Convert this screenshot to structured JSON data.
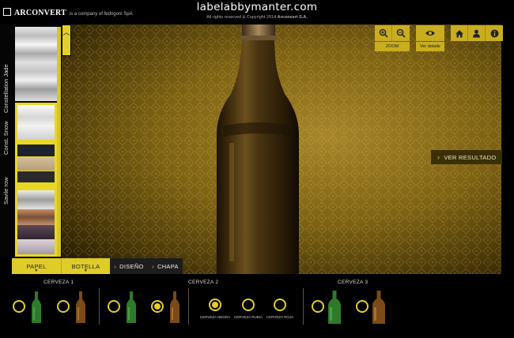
{
  "header": {
    "brand_name": "ARCONVERT",
    "brand_tagline": "is a company of fedrigoni SpA",
    "site_title": "labelabbymanter.com",
    "copyright_prefix": "All rights reserved & Copyright 2014",
    "copyright_company": "Arconvert S.A."
  },
  "sidebar": {
    "categories": [
      {
        "label": "Constellation Jade"
      },
      {
        "label": "Const. Snow"
      },
      {
        "label": "Savile row"
      }
    ]
  },
  "toolbar": {
    "zoom_label": "ZOOM",
    "detail_label": "Ver detalle",
    "zoom_in_icon": "zoom-in-icon",
    "zoom_out_icon": "zoom-out-icon",
    "eye_icon": "eye-icon",
    "home_icon": "home-icon",
    "user_icon": "user-icon",
    "info_icon": "info-icon",
    "accent_color": "#c8ad1f"
  },
  "stage": {
    "result_button": "VER RESULTADO"
  },
  "tabs": [
    {
      "label": "PAPEL"
    },
    {
      "label": "BOTELLA"
    },
    {
      "label": "DISEÑO"
    },
    {
      "label": "CHAPA"
    }
  ],
  "groups": [
    {
      "title": "CERVEZA 1"
    },
    {
      "title": "CERVEZA 2",
      "options": [
        "CERVEZA NEGRA",
        "CERVEZA RUBIA",
        "CERVEZA ROJA"
      ]
    },
    {
      "title": "CERVEZA 3"
    }
  ]
}
